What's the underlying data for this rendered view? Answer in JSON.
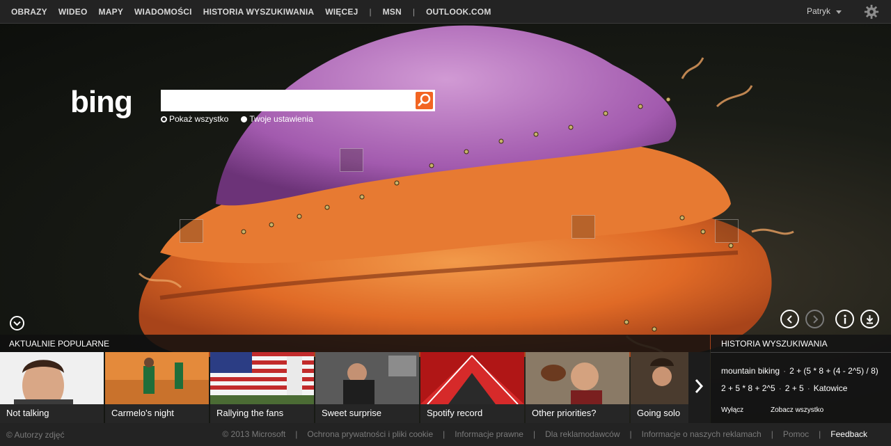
{
  "topnav": {
    "items": [
      "OBRAZY",
      "WIDEO",
      "MAPY",
      "WIADOMOŚCI",
      "HISTORIA WYSZUKIWANIA",
      "WIĘCEJ"
    ],
    "separator": "|",
    "msn": "MSN",
    "outlook": "OUTLOOK.COM",
    "user": "Patryk"
  },
  "logo": {
    "text": "bing"
  },
  "search": {
    "value": "",
    "options": [
      "Pokaż wszystko",
      "Twoje ustawienia"
    ],
    "selected_option": "Pokaż wszystko"
  },
  "trending": {
    "title": "AKTUALNIE POPULARNE",
    "tiles": [
      "Not talking",
      "Carmelo's night",
      "Rallying the fans",
      "Sweet surprise",
      "Spotify record",
      "Other priorities?",
      "Going solo"
    ]
  },
  "history": {
    "title": "HISTORIA WYSZUKIWANIA",
    "row1": [
      "mountain biking",
      "2 + (5 * 8 + (4 - 2^5) / 8)"
    ],
    "row2": [
      "2 + 5 * 8 + 2^5",
      "2 + 5",
      "Katowice"
    ],
    "bullet": "·",
    "disable": "Wyłącz",
    "see_all": "Zobacz wszystko"
  },
  "footer": {
    "credit": "© Autorzy zdjęć",
    "links": [
      "© 2013 Microsoft",
      "Ochrona prywatności i pliki cookie",
      "Informacje prawne",
      "Dla reklamodawców",
      "Informacje o naszych reklamach",
      "Pomoc"
    ],
    "separator": "|",
    "feedback": "Feedback"
  },
  "colors": {
    "search_button": "#f26522",
    "topbar": "#232323",
    "scallop_orange": "#e8772e",
    "scallop_purple": "#b168b8"
  }
}
